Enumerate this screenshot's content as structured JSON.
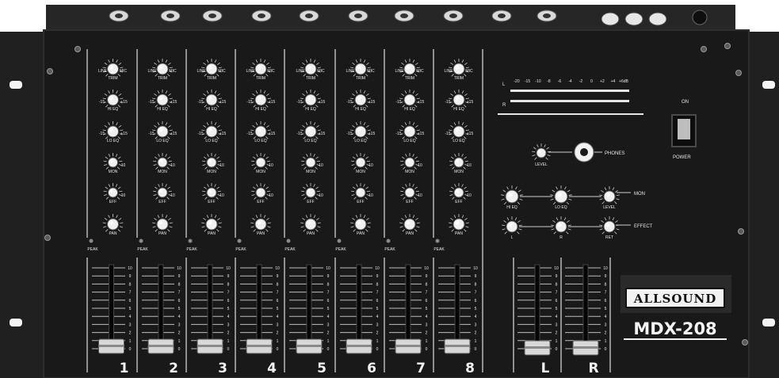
{
  "device": {
    "brand": "ALLSOUND",
    "model": "MDX-208"
  },
  "channel_strip": {
    "knob_labels": [
      "TRIM",
      "HI EQ",
      "LO EQ",
      "MON",
      "EFF",
      "PAN"
    ],
    "trim_range_left": "LINE",
    "trim_range_right": "MIC",
    "eq_left": "-15",
    "eq_right": "+15",
    "send_right": "10",
    "peak_label": "PEAK",
    "fader_scale": [
      "10",
      "9",
      "8",
      "7",
      "6",
      "5",
      "4",
      "3",
      "2",
      "1",
      "0"
    ]
  },
  "channel_numbers": [
    "1",
    "2",
    "3",
    "4",
    "5",
    "6",
    "7",
    "8"
  ],
  "master": {
    "meter_scale": [
      "-20",
      "-15",
      "-10",
      "-8",
      "-6",
      "-4",
      "-2",
      "0",
      "+2",
      "+4",
      "+6dB"
    ],
    "meter_left": "L",
    "meter_right": "R",
    "phones_label": "PHONES",
    "phones_level_label": "LEVEL",
    "row_mon_label": "MON",
    "row_effect_label": "EFFECT",
    "mon_knob_labels": [
      "HI EQ",
      "LO EQ",
      "LEVEL"
    ],
    "effect_knob_labels": [
      "L",
      "R",
      "RET"
    ],
    "power_on_label": "ON",
    "power_label": "POWER",
    "master_fader_labels": [
      "L",
      "R"
    ]
  }
}
